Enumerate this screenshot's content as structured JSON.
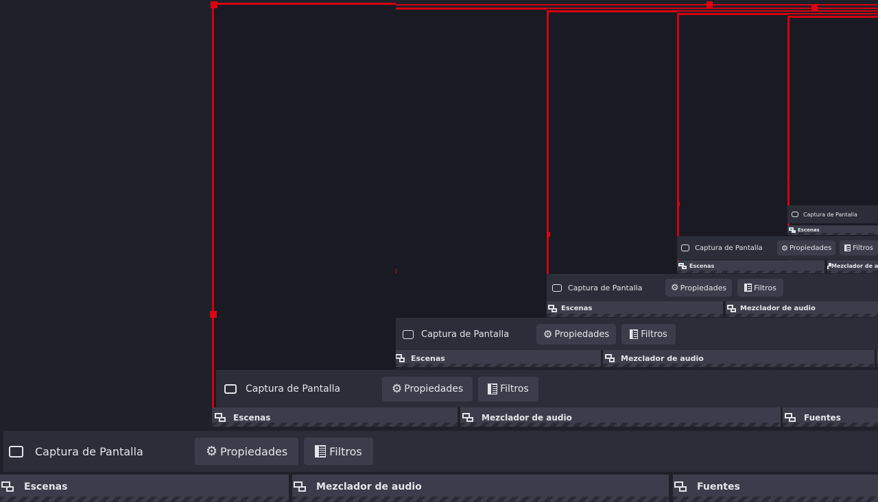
{
  "source_toolbar": {
    "source_name": "Captura de Pantalla",
    "properties_label": "Propiedades",
    "filters_label": "Filtros",
    "source_icon": "monitor-icon",
    "properties_icon": "gear-icon",
    "filters_icon": "filter-icon"
  },
  "docks": {
    "scenes_label": "Escenas",
    "audio_mixer_label": "Mezclador de audio",
    "sources_label": "Fuentes"
  },
  "colors": {
    "background": "#1f212a",
    "preview_background": "#191a24",
    "selection_red": "#d7000f",
    "toolbar": "#2b2e38",
    "button": "#3b3e4a",
    "text": "#e4e5ea"
  }
}
